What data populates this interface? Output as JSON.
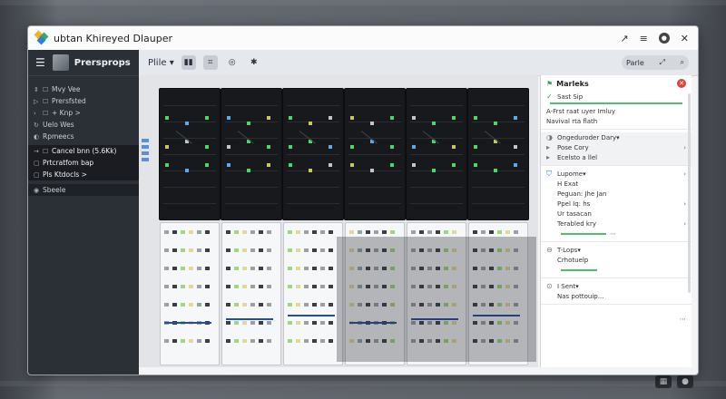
{
  "window": {
    "title": "ubtan Khireyed Dlauper"
  },
  "titlebar_icons": [
    "share-icon",
    "menu-icon",
    "profile-icon",
    "close-icon"
  ],
  "sidebar": {
    "title": "Prersprops",
    "items": [
      {
        "label": "Mvy Vee",
        "icon": "arrows-icon"
      },
      {
        "label": "Prersfsted",
        "icon": "play-icon"
      },
      {
        "label": "+ Knp >",
        "icon": "chevron-icon"
      },
      {
        "label": "Uelo Wes",
        "icon": "refresh-icon"
      },
      {
        "label": "Rpmeecs",
        "icon": "circle-icon"
      },
      {
        "label": "Cancel bnn (5.6Kk)",
        "icon": "arrow-icon"
      },
      {
        "label": "Prtcratfom bap",
        "icon": "square-icon"
      },
      {
        "label": "Pls Ktdocls >",
        "icon": "square-icon"
      },
      {
        "label": "Sbeele",
        "icon": "disk-icon"
      }
    ]
  },
  "toolbar": {
    "view_select": "Plile",
    "search_label": "Parle"
  },
  "panel": {
    "header": "Marleks",
    "sections": [
      {
        "title": "Sast Sip",
        "lines": [
          "A-Frst raat uyer Imluy",
          "Navival rta flath"
        ]
      },
      {
        "title": "Ongeduroder Dary",
        "lines": [
          "Pose Cory",
          "Ecelsto a llel"
        ]
      },
      {
        "title": "Lupome",
        "lines": [
          "H Exat",
          "Peguan: Jhe Jan",
          "Ppel Iq: hs",
          "Ur tasacan",
          "Terabled kry"
        ]
      },
      {
        "title": "T-Lops",
        "lines": [
          "Crhotuelp"
        ]
      },
      {
        "title": "I Sent",
        "lines": [
          "Nas pottouip..."
        ]
      }
    ]
  },
  "colors": {
    "accent": "#2f6fd6",
    "ok": "#4fbf6b",
    "alert": "#d9473f",
    "sidebar_bg": "#2b2f36"
  }
}
